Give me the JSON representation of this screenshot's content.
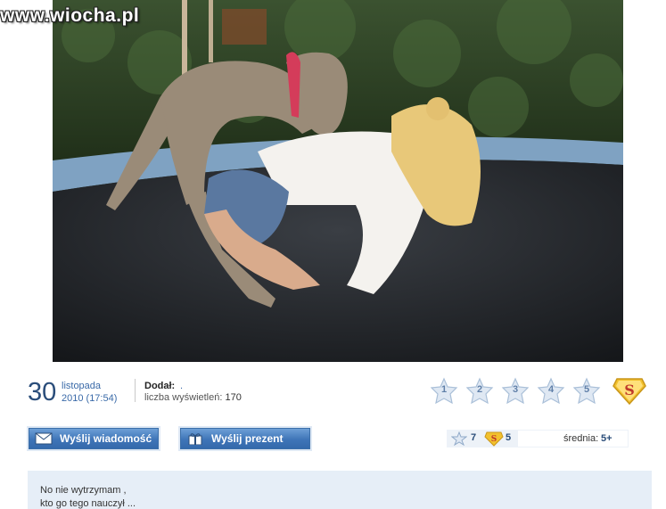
{
  "site": {
    "watermark": "www.wiocha.pl"
  },
  "post": {
    "day": "30",
    "month": "listopada",
    "year_time": "2010 (17:54)",
    "added_label": "Dodał:",
    "added_user": ".",
    "views_label": "liczba wyświetleń:",
    "views_count": "170"
  },
  "rating": {
    "stars": [
      "1",
      "2",
      "3",
      "4",
      "5"
    ],
    "super_icon": "super-s-icon"
  },
  "actions": {
    "send_message": "Wyślij wiadomość",
    "send_gift": "Wyślij prezent"
  },
  "stats": {
    "star_votes": "7",
    "super_votes": "5",
    "average_label": "średnia:",
    "average_value": "5+"
  },
  "description": {
    "line1": "No nie wytrzymam ,",
    "line2": "kto go tego nauczył ..."
  },
  "colors": {
    "accent": "#3a6aa8",
    "button": "#3f75b8",
    "badge": "#f2c12e"
  }
}
